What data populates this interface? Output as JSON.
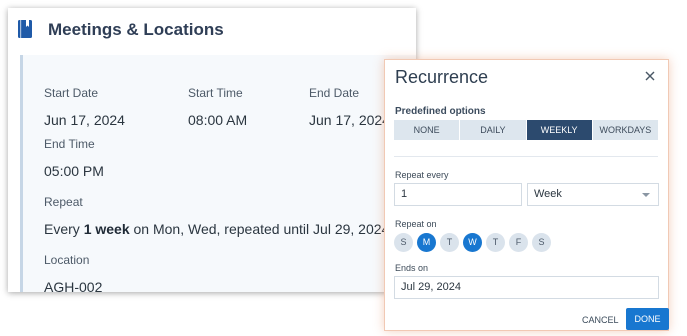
{
  "panel": {
    "title": "Meetings & Locations",
    "fields": {
      "start_date_label": "Start Date",
      "start_date_value": "Jun 17, 2024",
      "start_time_label": "Start Time",
      "start_time_value": "08:00 AM",
      "end_date_label": "End Date",
      "end_date_value": "Jun 17, 2024",
      "end_time_label": "End Time",
      "end_time_value": "05:00 PM",
      "repeat_label": "Repeat",
      "repeat_prefix": "Every ",
      "repeat_bold": "1 week",
      "repeat_suffix": " on Mon, Wed, repeated until Jul 29, 2024",
      "location_label": "Location",
      "location_value": "AGH-002"
    }
  },
  "dialog": {
    "title": "Recurrence",
    "predefined_label": "Predefined options",
    "options": [
      "NONE",
      "DAILY",
      "WEEKLY",
      "WORKDAYS"
    ],
    "selected_option": "WEEKLY",
    "repeat_every_label": "Repeat every",
    "repeat_every_value": "1",
    "repeat_unit_value": "Week",
    "repeat_on_label": "Repeat on",
    "days": [
      {
        "label": "S",
        "on": false
      },
      {
        "label": "M",
        "on": true
      },
      {
        "label": "T",
        "on": false
      },
      {
        "label": "W",
        "on": true
      },
      {
        "label": "T",
        "on": false
      },
      {
        "label": "F",
        "on": false
      },
      {
        "label": "S",
        "on": false
      }
    ],
    "ends_on_label": "Ends on",
    "ends_on_value": "Jul 29, 2024",
    "cancel_label": "CANCEL",
    "done_label": "DONE"
  },
  "colors": {
    "accent": "#1877d0",
    "selected_segment": "#2c4a6e",
    "icon": "#1f5aa8"
  }
}
